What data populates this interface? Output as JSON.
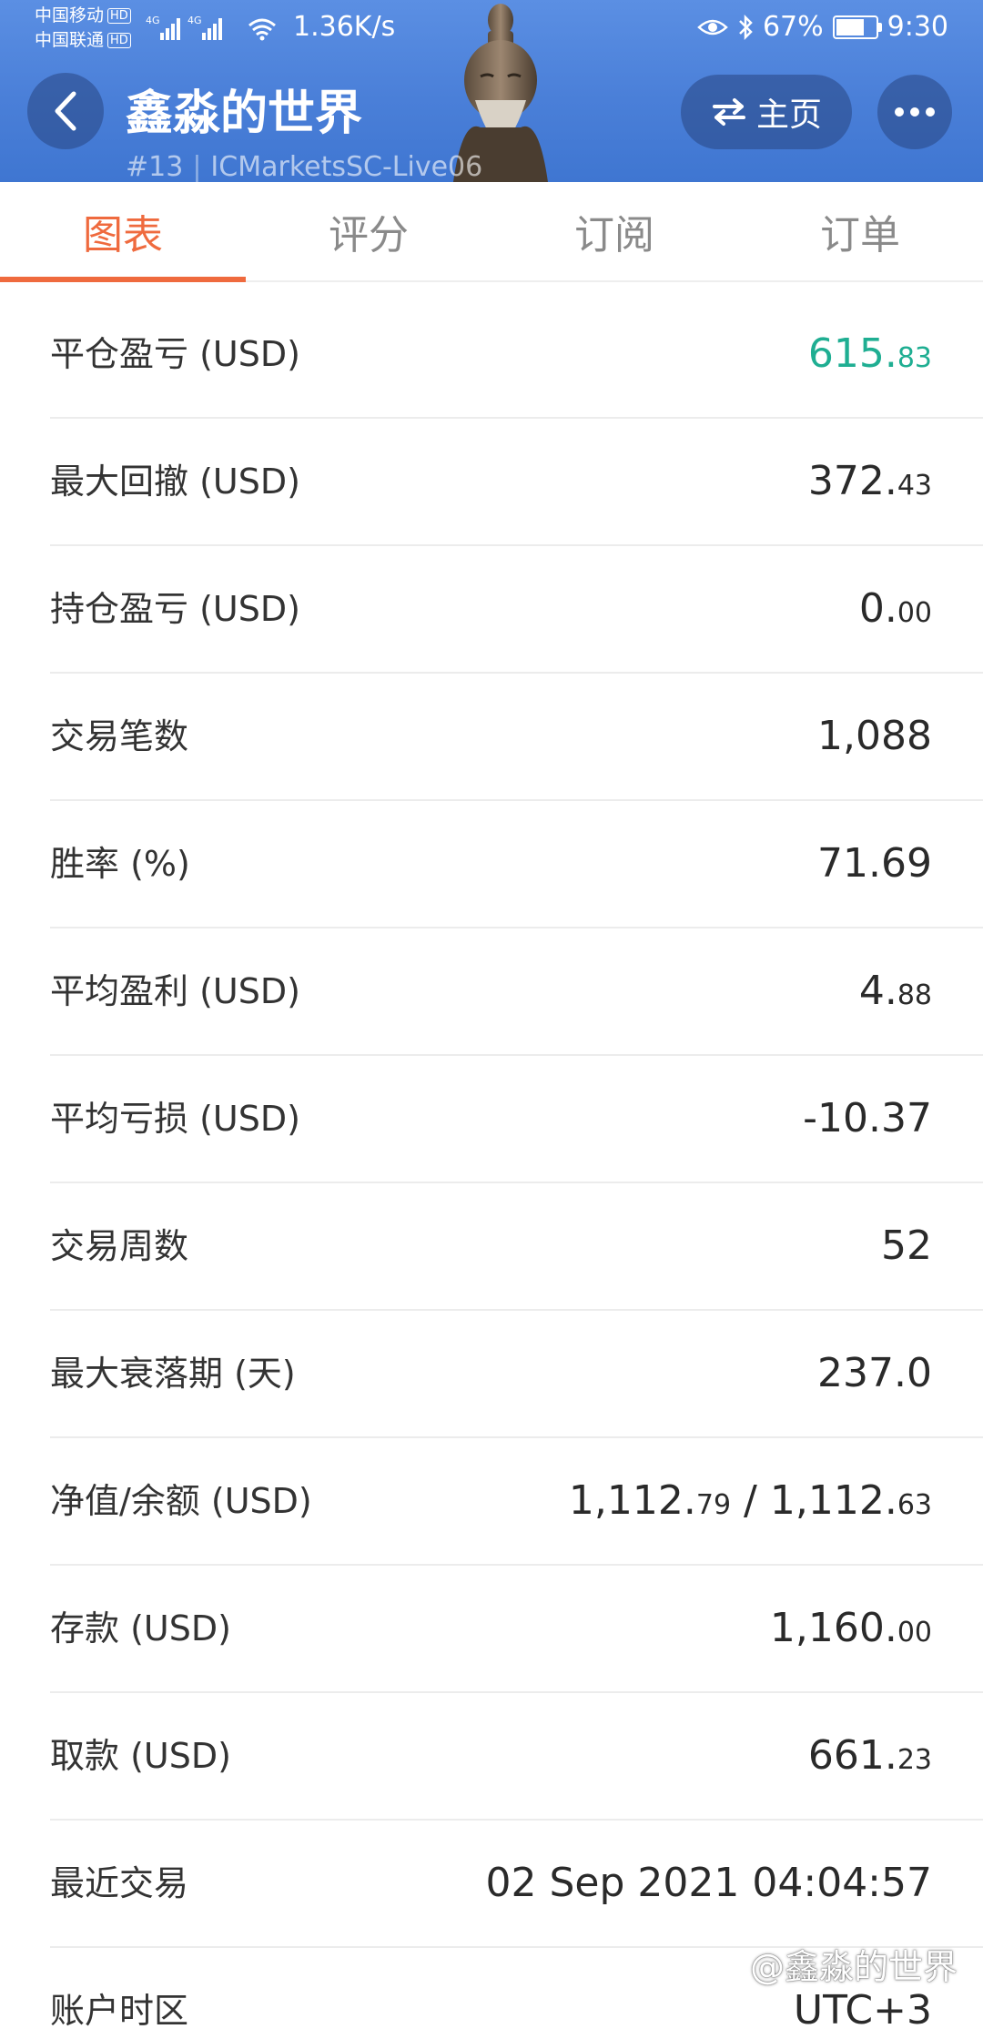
{
  "status_bar": {
    "carrier1": "中国移动",
    "carrier2": "中国联通",
    "hd": "HD",
    "net1": "4G",
    "net2": "4G",
    "speed": "1.36K/s",
    "battery": "67%",
    "time": "9:30"
  },
  "header": {
    "title": "鑫淼的世界",
    "rank": "#13",
    "account": "ICMarketsSC-Live06",
    "home_label": "主页"
  },
  "tabs": [
    {
      "label": "图表",
      "active": true
    },
    {
      "label": "评分",
      "active": false
    },
    {
      "label": "订阅",
      "active": false
    },
    {
      "label": "订单",
      "active": false
    }
  ],
  "stats": [
    {
      "label": "平仓盈亏 (USD)",
      "int": "615.",
      "dec": "83",
      "color": "#1fae92"
    },
    {
      "label": "最大回撤 (USD)",
      "int": "372.",
      "dec": "43"
    },
    {
      "label": "持仓盈亏 (USD)",
      "int": "0.",
      "dec": "00"
    },
    {
      "label": "交易笔数",
      "int": "1,088",
      "dec": ""
    },
    {
      "label": "胜率 (%)",
      "int": "71.69",
      "dec": ""
    },
    {
      "label": "平均盈利 (USD)",
      "int": "4.",
      "dec": "88"
    },
    {
      "label": "平均亏损 (USD)",
      "int": "-10.37",
      "dec": ""
    },
    {
      "label": "交易周数",
      "int": "52",
      "dec": ""
    },
    {
      "label": "最大衰落期 (天)",
      "int": "237.0",
      "dec": ""
    },
    {
      "label": "净值/余额 (USD)",
      "int": "1,112.",
      "dec": "79",
      "int2": " / 1,112.",
      "dec2": "63"
    },
    {
      "label": "存款 (USD)",
      "int": "1,160.",
      "dec": "00"
    },
    {
      "label": "取款 (USD)",
      "int": "661.",
      "dec": "23"
    },
    {
      "label": "最近交易",
      "int": "02 Sep 2021 04:04:57",
      "dec": ""
    },
    {
      "label": "账户时区",
      "int": "UTC+3",
      "dec": ""
    }
  ],
  "watermark": "@鑫淼的世界"
}
